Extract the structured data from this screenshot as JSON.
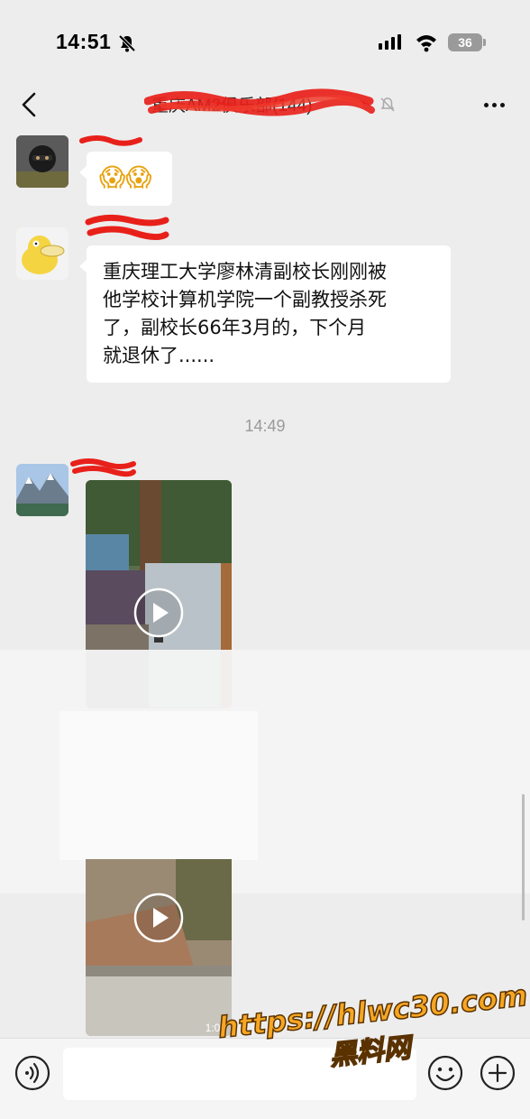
{
  "status_bar": {
    "time": "14:51",
    "battery": "36"
  },
  "header": {
    "title": "重庆AM2俱乐部(144)"
  },
  "messages": [
    {
      "type": "emoji",
      "text": "😱😱"
    },
    {
      "type": "text",
      "lines": [
        "重庆理工大学廖林清副校长刚刚被",
        "他学校计算机学院一个副教授杀死",
        "了，副校长66年3月的，下个月",
        "就退休了......"
      ]
    },
    {
      "type": "timestamp",
      "text": "14:49"
    },
    {
      "type": "video",
      "duration": ""
    },
    {
      "type": "video",
      "duration": "1:01"
    }
  ],
  "watermark": {
    "url": "https://hlwc30.com",
    "name": "黑料网"
  },
  "colors": {
    "background": "#ededed",
    "bubble": "#ffffff",
    "scribble": "#e8201a"
  }
}
